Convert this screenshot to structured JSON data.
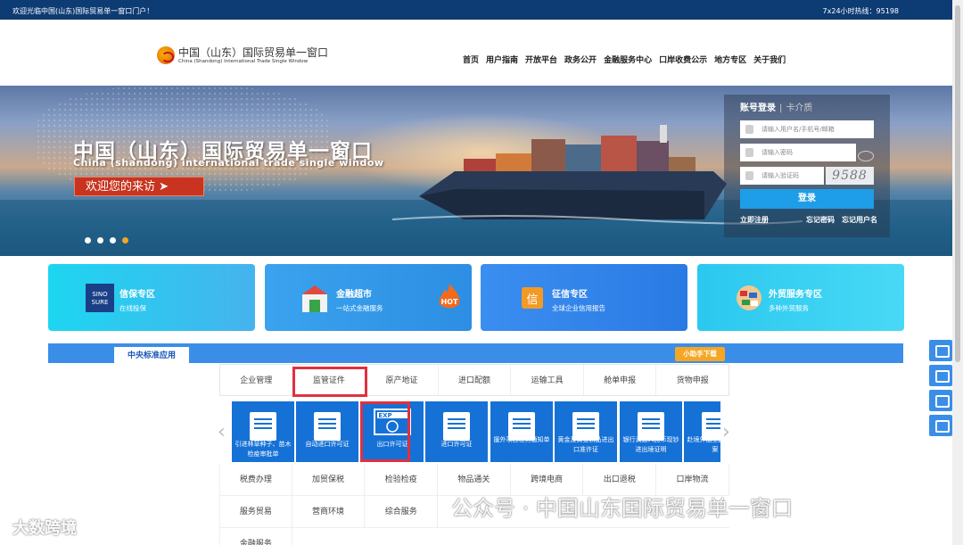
{
  "topbar": {
    "welcome": "欢迎光临中国(山东)国际贸易单一窗口门户！",
    "hotline": "7x24小时热线：95198"
  },
  "logo": {
    "cn": "中国（山东）国际贸易单一窗口",
    "en": "China (Shandong) International Trade Single Window"
  },
  "nav": [
    "首页",
    "用户指南",
    "开放平台",
    "政务公开",
    "金融服务中心",
    "口岸收费公示",
    "地方专区",
    "关于我们"
  ],
  "banner": {
    "title": "中国（山东）国际贸易单一窗口",
    "subtitle": "China (shandong) international trade single window",
    "button": "欢迎您的来访 ➤",
    "slides": 4,
    "active_slide": 4
  },
  "login": {
    "tab_active": "账号登录",
    "tab_sep": "|",
    "tab_inactive": "卡介质",
    "username_placeholder": "请输入用户名/手机号/邮箱",
    "password_placeholder": "请输入密码",
    "captcha_placeholder": "请输入验证码",
    "captcha_value": "9588",
    "submit": "登录",
    "register": "立即注册",
    "forgot_password": "忘记密码",
    "forgot_username": "忘记用户名"
  },
  "cards": [
    {
      "title": "信保专区",
      "sub": "在线投保",
      "icon": "sinosure-logo-icon"
    },
    {
      "title": "金融超市",
      "sub": "一站式金融服务",
      "icon": "bank-building-icon"
    },
    {
      "title": "征信专区",
      "sub": "全球企业信用报告",
      "icon": "credit-seal-icon"
    },
    {
      "title": "外贸服务专区",
      "sub": "多种外贸服务",
      "icon": "globe-flags-icon"
    }
  ],
  "section": {
    "tab": "中央标准应用",
    "helper": "小助手下载"
  },
  "categories": [
    "企业管理",
    "监管证件",
    "原产地证",
    "进口配额",
    "运输工具",
    "舱单申报",
    "货物申报"
  ],
  "tiles": [
    {
      "label": "引进林草种子、苗木检疫审批单",
      "icon": "document-icon"
    },
    {
      "label": "自动进口许可证",
      "icon": "gear-document-icon"
    },
    {
      "label": "出口许可证",
      "icon": "exp-card-icon"
    },
    {
      "label": "进口许可证",
      "icon": "imp-card-icon"
    },
    {
      "label": "援外项目任务通知单",
      "icon": "notice-icon"
    },
    {
      "label": "黄金及黄金制品进出口准许证",
      "icon": "gold-permit-icon"
    },
    {
      "label": "银行调运人民币现钞进出境证明",
      "icon": "currency-cert-icon"
    },
    {
      "label": "赴境外加工复进口备案",
      "icon": "processing-icon"
    }
  ],
  "grid": [
    [
      "税费办理",
      "加贸保税",
      "检验检疫",
      "物品通关",
      "跨境电商",
      "出口退税",
      "口岸物流"
    ],
    [
      "服务贸易",
      "营商环境",
      "综合服务"
    ],
    [
      "金融服务"
    ]
  ],
  "watermark_left": "大数跨境",
  "watermark_right": "公众号 · 中国山东国际贸易单一窗口"
}
